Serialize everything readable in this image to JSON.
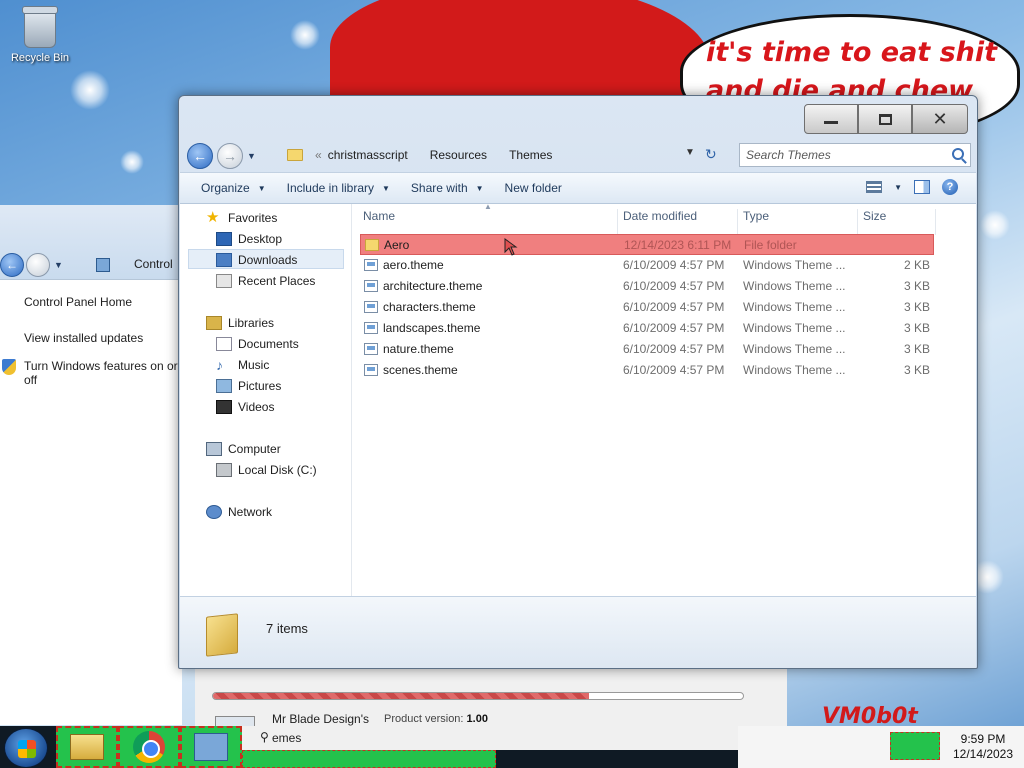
{
  "desktop": {
    "recycle_bin_label": "Recycle Bin",
    "speech_bubble_text": "it's time to eat shit and die and chew",
    "watermark": "VM0b0t"
  },
  "control_panel": {
    "title": "Control",
    "links": [
      "Control Panel Home",
      "View installed updates",
      "Turn Windows features on or off"
    ]
  },
  "installer": {
    "product_name": "Mr Blade Design's",
    "version_label": "Product version:",
    "version_value": "1.00",
    "progress": 0.71
  },
  "explorer": {
    "breadcrumb": [
      "christmasscript",
      "Resources",
      "Themes"
    ],
    "search_placeholder": "Search Themes",
    "commands": {
      "organize": "Organize",
      "include_in_library": "Include in library",
      "share_with": "Share with",
      "new_folder": "New folder"
    },
    "nav": {
      "favorites": "Favorites",
      "desktop": "Desktop",
      "downloads": "Downloads",
      "recent_places": "Recent Places",
      "libraries": "Libraries",
      "documents": "Documents",
      "music": "Music",
      "pictures": "Pictures",
      "videos": "Videos",
      "computer": "Computer",
      "local_disk": "Local Disk (C:)",
      "network": "Network"
    },
    "columns": {
      "name": "Name",
      "date_modified": "Date modified",
      "type": "Type",
      "size": "Size"
    },
    "files": [
      {
        "name": "Aero",
        "date": "12/14/2023 6:11 PM",
        "type": "File folder",
        "size": ""
      },
      {
        "name": "aero.theme",
        "date": "6/10/2009 4:57 PM",
        "type": "Windows Theme ...",
        "size": "2 KB"
      },
      {
        "name": "architecture.theme",
        "date": "6/10/2009 4:57 PM",
        "type": "Windows Theme ...",
        "size": "3 KB"
      },
      {
        "name": "characters.theme",
        "date": "6/10/2009 4:57 PM",
        "type": "Windows Theme ...",
        "size": "3 KB"
      },
      {
        "name": "landscapes.theme",
        "date": "6/10/2009 4:57 PM",
        "type": "Windows Theme ...",
        "size": "3 KB"
      },
      {
        "name": "nature.theme",
        "date": "6/10/2009 4:57 PM",
        "type": "Windows Theme ...",
        "size": "3 KB"
      },
      {
        "name": "scenes.theme",
        "date": "6/10/2009 4:57 PM",
        "type": "Windows Theme ...",
        "size": "3 KB"
      }
    ],
    "item_count": "7 items"
  },
  "taskbar": {
    "search_text": "emes",
    "clock_time": "9:59 PM",
    "clock_date": "12/14/2023"
  }
}
